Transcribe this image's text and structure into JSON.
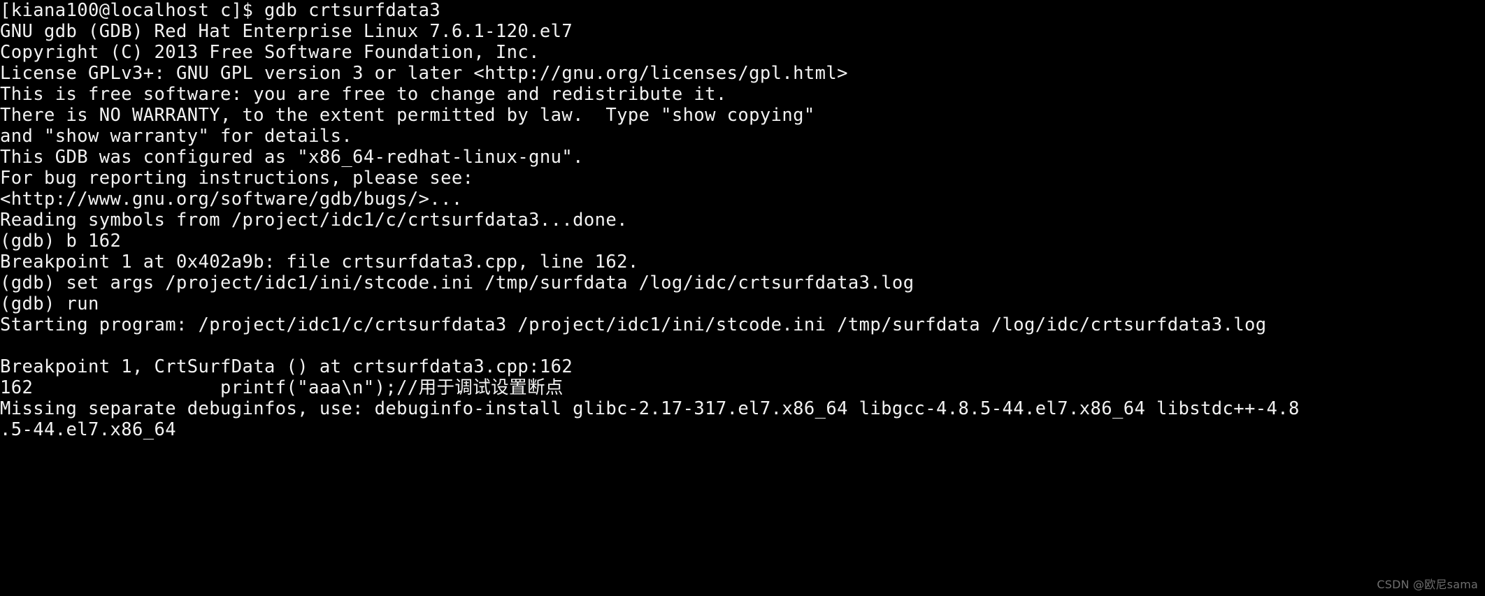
{
  "terminal": {
    "background_color": "#000000",
    "foreground_color": "#f2f2f2",
    "lines": [
      {
        "id": "prompt-gdb-launch",
        "text": "[kiana100@localhost c]$ gdb crtsurfdata3"
      },
      {
        "id": "gdb-version",
        "text": "GNU gdb (GDB) Red Hat Enterprise Linux 7.6.1-120.el7"
      },
      {
        "id": "copyright",
        "text": "Copyright (C) 2013 Free Software Foundation, Inc."
      },
      {
        "id": "license",
        "text": "License GPLv3+: GNU GPL version 3 or later <http://gnu.org/licenses/gpl.html>"
      },
      {
        "id": "free-software",
        "text": "This is free software: you are free to change and redistribute it."
      },
      {
        "id": "no-warranty",
        "text": "There is NO WARRANTY, to the extent permitted by law.  Type \"show copying\""
      },
      {
        "id": "show-warranty",
        "text": "and \"show warranty\" for details."
      },
      {
        "id": "configured-as",
        "text": "This GDB was configured as \"x86_64-redhat-linux-gnu\"."
      },
      {
        "id": "bug-reporting",
        "text": "For bug reporting instructions, please see:"
      },
      {
        "id": "bug-url",
        "text": "<http://www.gnu.org/software/gdb/bugs/>..."
      },
      {
        "id": "reading-symbols",
        "text": "Reading symbols from /project/idc1/c/crtsurfdata3...done."
      },
      {
        "id": "cmd-break",
        "text": "(gdb) b 162"
      },
      {
        "id": "breakpoint-set",
        "text": "Breakpoint 1 at 0x402a9b: file crtsurfdata3.cpp, line 162."
      },
      {
        "id": "cmd-set-args",
        "text": "(gdb) set args /project/idc1/ini/stcode.ini /tmp/surfdata /log/idc/crtsurfdata3.log"
      },
      {
        "id": "cmd-run",
        "text": "(gdb) run"
      },
      {
        "id": "starting-program",
        "text": "Starting program: /project/idc1/c/crtsurfdata3 /project/idc1/ini/stcode.ini /tmp/surfdata /log/idc/crtsurfdata3.log"
      },
      {
        "id": "blank-1",
        "text": ""
      },
      {
        "id": "breakpoint-hit",
        "text": "Breakpoint 1, CrtSurfData () at crtsurfdata3.cpp:162"
      },
      {
        "id": "source-line-162",
        "text": "162                 printf(\"aaa\\n\");//用于调试设置断点"
      },
      {
        "id": "missing-debuginfos",
        "text": "Missing separate debuginfos, use: debuginfo-install glibc-2.17-317.el7.x86_64 libgcc-4.8.5-44.el7.x86_64 libstdc++-4.8"
      },
      {
        "id": "missing-debuginfos-wrap",
        "text": ".5-44.el7.x86_64"
      }
    ]
  },
  "watermark": {
    "text": "CSDN @欧尼sama",
    "color": "#6f6f6f"
  }
}
